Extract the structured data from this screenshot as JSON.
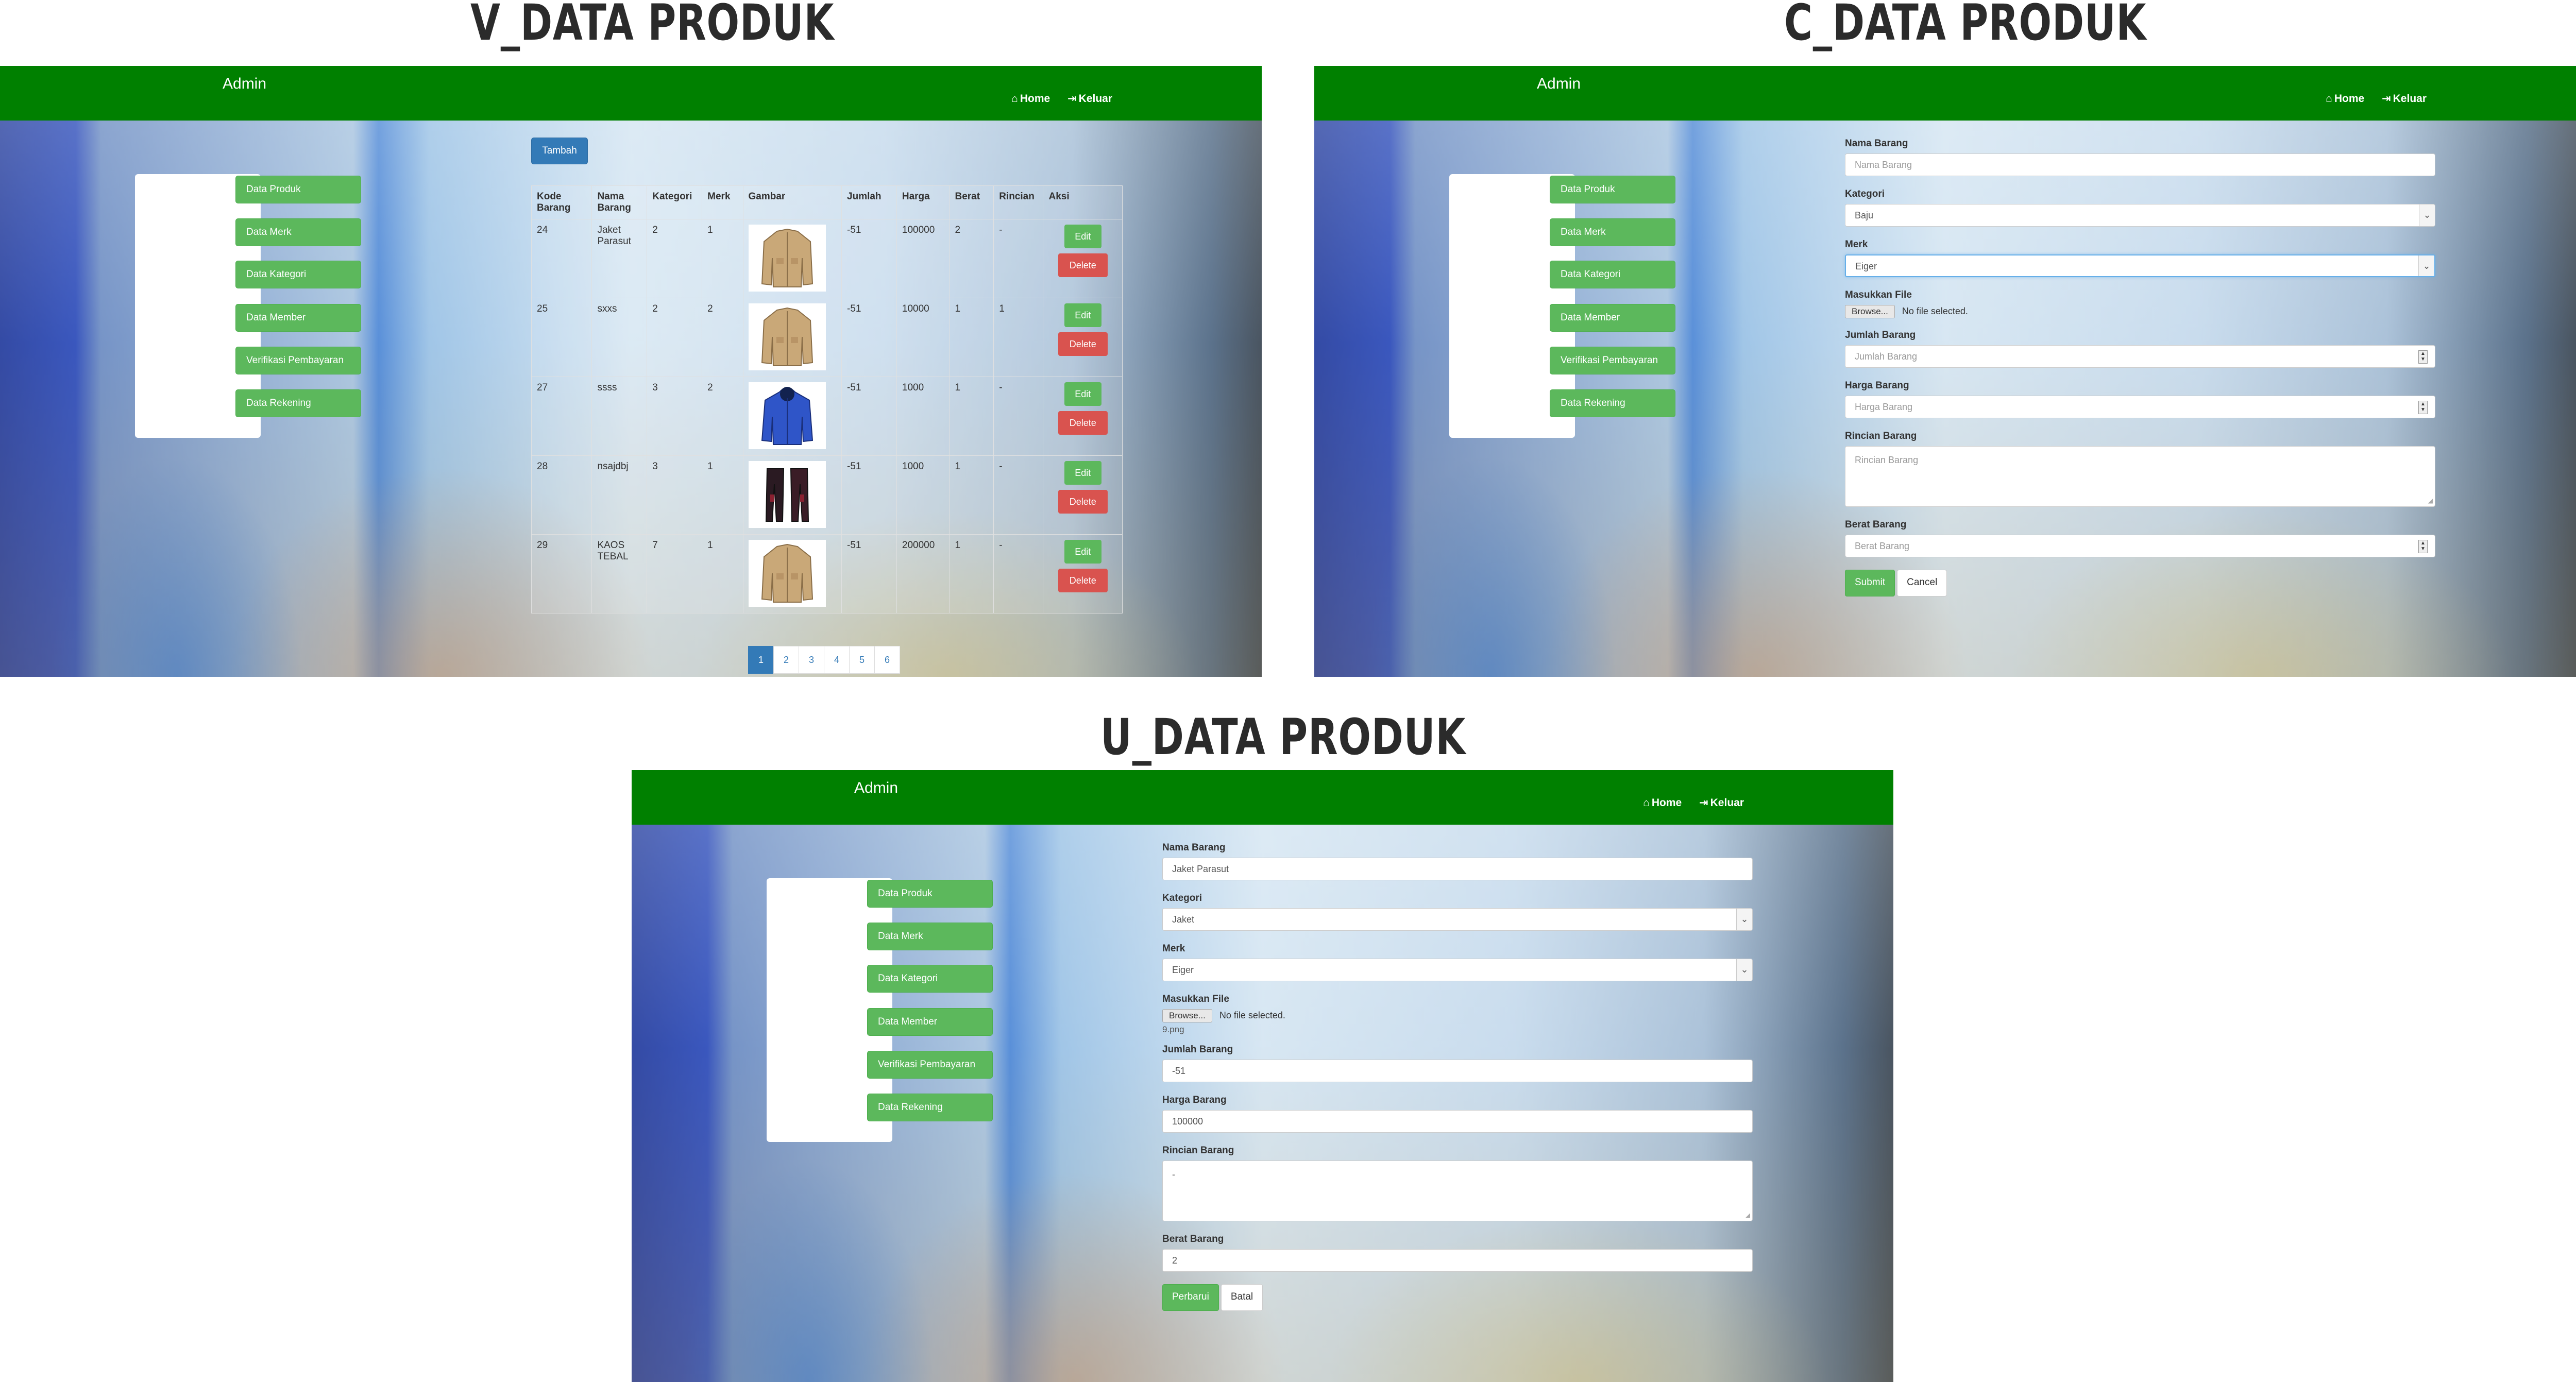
{
  "titles": {
    "v": "V_DATA PRODUK",
    "c": "C_DATA PRODUK",
    "u": "U_DATA PRODUK"
  },
  "navbar": {
    "brand": "Admin",
    "home": "Home",
    "logout": "Keluar"
  },
  "sidebar": {
    "items": [
      {
        "label": "Data Produk"
      },
      {
        "label": "Data Merk"
      },
      {
        "label": "Data Kategori"
      },
      {
        "label": "Data Member"
      },
      {
        "label": "Verifikasi Pembayaran"
      },
      {
        "label": "Data Rekening"
      }
    ]
  },
  "v_page": {
    "add_button": "Tambah",
    "columns": [
      "Kode Barang",
      "Nama Barang",
      "Kategori",
      "Merk",
      "Gambar",
      "Jumlah",
      "Harga",
      "Berat",
      "Rincian",
      "Aksi"
    ],
    "rows": [
      {
        "kode": "24",
        "nama": "Jaket Parasut",
        "kategori": "2",
        "merk": "1",
        "gambar": "jacket-tan",
        "jumlah": "-51",
        "harga": "100000",
        "berat": "2",
        "rincian": "-"
      },
      {
        "kode": "25",
        "nama": "sxxs",
        "kategori": "2",
        "merk": "2",
        "gambar": "jacket-tan",
        "jumlah": "-51",
        "harga": "10000",
        "berat": "1",
        "rincian": "1"
      },
      {
        "kode": "27",
        "nama": "ssss",
        "kategori": "3",
        "merk": "2",
        "gambar": "jacket-blue",
        "jumlah": "-51",
        "harga": "1000",
        "berat": "1",
        "rincian": "-"
      },
      {
        "kode": "28",
        "nama": "nsajdbj",
        "kategori": "3",
        "merk": "1",
        "gambar": "pants",
        "jumlah": "-51",
        "harga": "1000",
        "berat": "1",
        "rincian": "-"
      },
      {
        "kode": "29",
        "nama": "KAOS TEBAL",
        "kategori": "7",
        "merk": "1",
        "gambar": "jacket-tan",
        "jumlah": "-51",
        "harga": "200000",
        "berat": "1",
        "rincian": "-"
      }
    ],
    "edit_label": "Edit",
    "delete_label": "Delete",
    "pages": [
      "1",
      "2",
      "3",
      "4",
      "5",
      "6"
    ],
    "active_page": "1"
  },
  "c_page": {
    "nama_label": "Nama Barang",
    "nama_placeholder": "Nama Barang",
    "kategori_label": "Kategori",
    "kategori_value": "Baju",
    "merk_label": "Merk",
    "merk_value": "Eiger",
    "file_label": "Masukkan File",
    "browse": "Browse...",
    "no_file": "No file selected.",
    "jumlah_label": "Jumlah Barang",
    "jumlah_placeholder": "Jumlah Barang",
    "harga_label": "Harga Barang",
    "harga_placeholder": "Harga Barang",
    "rincian_label": "Rincian Barang",
    "rincian_placeholder": "Rincian Barang",
    "berat_label": "Berat Barang",
    "berat_placeholder": "Berat Barang",
    "submit": "Submit",
    "cancel": "Cancel"
  },
  "u_page": {
    "nama_label": "Nama Barang",
    "nama_value": "Jaket Parasut",
    "kategori_label": "Kategori",
    "kategori_value": "Jaket",
    "merk_label": "Merk",
    "merk_value": "Eiger",
    "file_label": "Masukkan File",
    "browse": "Browse...",
    "no_file": "No file selected.",
    "current_file": "9.png",
    "jumlah_label": "Jumlah Barang",
    "jumlah_value": "-51",
    "harga_label": "Harga Barang",
    "harga_value": "100000",
    "rincian_label": "Rincian Barang",
    "rincian_value": "-",
    "berat_label": "Berat Barang",
    "berat_value": "2",
    "submit": "Perbarui",
    "cancel": "Batal"
  },
  "colors": {
    "navbar": "#008000",
    "success": "#5cb85c",
    "danger": "#d9534f",
    "primary": "#337ab7"
  }
}
